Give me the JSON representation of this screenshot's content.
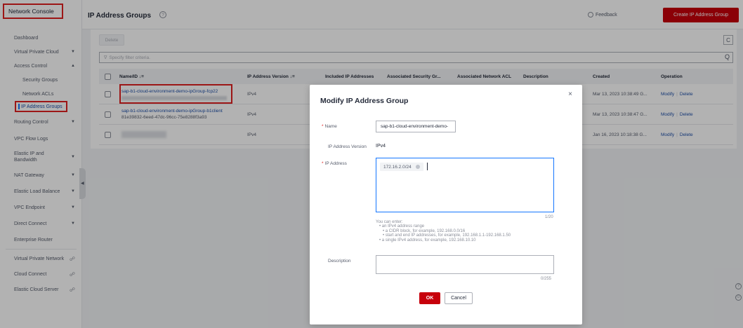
{
  "sidebar": {
    "brand": "Network Console",
    "items": [
      {
        "label": "Dashboard",
        "chevron": ""
      },
      {
        "label": "Virtual Private Cloud",
        "chevron": "▼"
      },
      {
        "label": "Access Control",
        "chevron": "▲"
      },
      {
        "label": "Security Groups",
        "chevron": ""
      },
      {
        "label": "Network ACLs",
        "chevron": ""
      },
      {
        "label": "IP Address Groups",
        "chevron": ""
      },
      {
        "label": "Routing Control",
        "chevron": "▼"
      },
      {
        "label": "VPC Flow Logs",
        "chevron": ""
      },
      {
        "label": "Elastic IP and Bandwidth",
        "chevron": "▼"
      },
      {
        "label": "NAT Gateway",
        "chevron": "▼"
      },
      {
        "label": "Elastic Load Balance",
        "chevron": "▼"
      },
      {
        "label": "VPC Endpoint",
        "chevron": "▼"
      },
      {
        "label": "Direct Connect",
        "chevron": "▼"
      },
      {
        "label": "Enterprise Router",
        "chevron": ""
      },
      {
        "label": "Virtual Private Network",
        "chevron": ""
      },
      {
        "label": "Cloud Connect",
        "chevron": ""
      },
      {
        "label": "Elastic Cloud Server",
        "chevron": ""
      }
    ]
  },
  "header": {
    "title": "IP Address Groups",
    "help_glyph": "?",
    "feedback": "Feedback",
    "create_button": "Create IP Address Group"
  },
  "toolbar": {
    "delete_label": "Delete",
    "refresh_glyph": "C",
    "filter_placeholder": "Specify filter criteria.",
    "filter_glyph": "∇",
    "search_glyph": "Q"
  },
  "table": {
    "columns": [
      "Name/ID",
      "IP Address Version",
      "Included IP Addresses",
      "Associated Security Gr...",
      "Associated Network ACL",
      "Description",
      "Created",
      "Operation"
    ],
    "sort_glyph": "↓≡",
    "rows": [
      {
        "name": "sap-b1-cloud-environment-demo-ipGroup-fcp22",
        "id": "",
        "version": "IPv4",
        "created": "Mar 13, 2023 10:38:49 G...",
        "modify": "Modify",
        "delete": "Delete"
      },
      {
        "name": "sap-b1-cloud-environment-demo-ipGroup-b1client",
        "id": "81e39832-6eed-47dc-96cc-75e8288f3a93",
        "version": "IPv4",
        "created": "Mar 13, 2023 10:38:47 G...",
        "modify": "Modify",
        "delete": "Delete"
      },
      {
        "name": "",
        "id": "",
        "version": "IPv4",
        "created": "Jan 16, 2023 10:18:38 G...",
        "modify": "Modify",
        "delete": "Delete"
      }
    ]
  },
  "modal": {
    "title": "Modify IP Address Group",
    "close_glyph": "×",
    "required_mark": "*",
    "name_label": "Name",
    "name_value": "sap-b1-cloud-environment-demo-",
    "version_label": "IP Address Version",
    "version_value": "IPv4",
    "ip_label": "IP Address",
    "ip_tag": "172.16.2.0/24",
    "ip_counter": "1/20",
    "hint_lines": [
      "You can enter:",
      "• an IPv4 address range",
      "• a CIDR block, for example, 192.168.0.0/16",
      "• start and end IP addresses, for example, 192.168.1.1-192.168.1.50",
      "• a single IPv4 address, for example, 192.168.10.10"
    ],
    "description_label": "Description",
    "description_counter": "0/255",
    "ok_label": "OK",
    "cancel_label": "Cancel"
  },
  "colors": {
    "primary_red": "#c7000b",
    "highlight_red": "#e02020",
    "link_blue": "#1e4fa8",
    "focus_blue": "#1476ff"
  }
}
